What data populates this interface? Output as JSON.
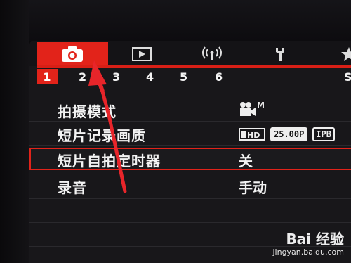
{
  "tabs": [
    {
      "icon": "camera-icon",
      "active": true
    },
    {
      "icon": "playback-icon",
      "active": false
    },
    {
      "icon": "wireless-icon",
      "active": false
    },
    {
      "icon": "wrench-icon",
      "active": false
    },
    {
      "icon": "star-icon",
      "active": false
    }
  ],
  "pages": [
    "1",
    "2",
    "3",
    "4",
    "5",
    "6",
    "S"
  ],
  "menu": {
    "rows": [
      {
        "label": "拍摄模式",
        "value_icon": "movie-mode-icon"
      },
      {
        "label": "短片记录画质",
        "value_badges": [
          "25.00P",
          "IPB"
        ]
      },
      {
        "label": "短片自拍定时器",
        "value": "关"
      },
      {
        "label": "录音",
        "value": "手动"
      }
    ]
  },
  "watermark": {
    "logo": "Bai 经验",
    "url": "jingyan.baidu.com"
  },
  "colors": {
    "accent": "#e2231a",
    "annotation_arrow": "#e8252a",
    "screen_bg": "#18171a"
  }
}
